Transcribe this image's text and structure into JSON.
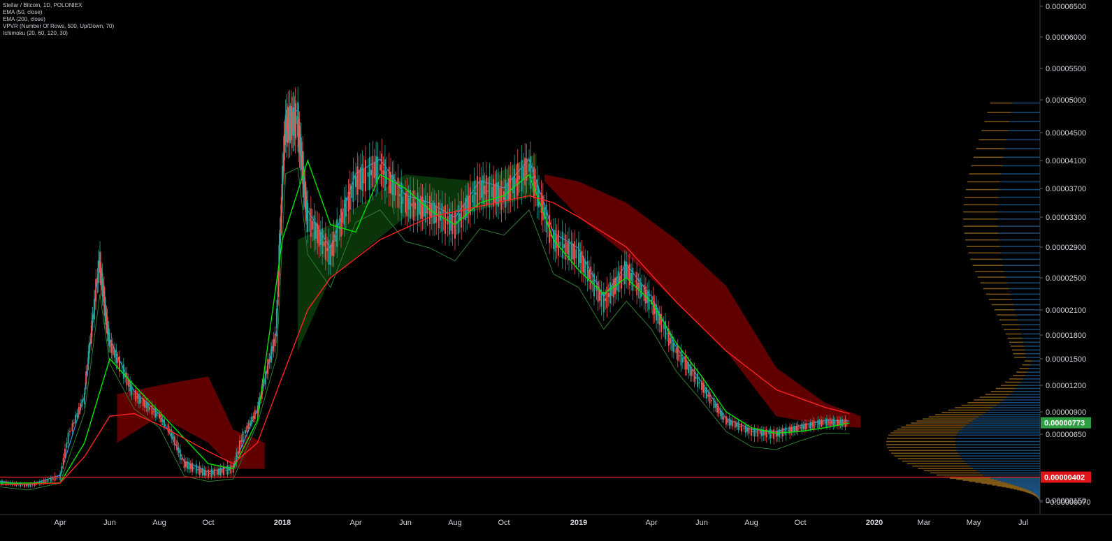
{
  "legend": {
    "symbol_line": "Stellar / Bitcoin, 1D, POLONIEX",
    "indicators": [
      "EMA (50, close)",
      "EMA (200, close)",
      "VPVR (Number Of Rows, 500, Up/Down, 70)",
      "Ichimoku (20, 60, 120, 30)"
    ]
  },
  "colors": {
    "background": "#000000",
    "candle_up": "#26a69a",
    "candle_down": "#ef5350",
    "ema50": "#00e600",
    "ema200": "#ff2222",
    "conversion_line": "#2196f3",
    "base_line": "#b71c1c",
    "lagging_span": "#2e7d32",
    "cloud_bearish": "#6b0000",
    "cloud_bullish": "#0b3a0b",
    "vpvr_up": "#1e5a8c",
    "vpvr_down": "#a0701c",
    "price_line": "#ff2222",
    "last_price_badge": "#2ea043",
    "level_badge": "#e0161b"
  },
  "chart_data": {
    "type": "candlestick",
    "title": "Stellar / Bitcoin, 1D, POLONIEX",
    "x_axis": {
      "tick_labels": [
        "Apr",
        "Jun",
        "Aug",
        "Oct",
        "2018",
        "Apr",
        "Jun",
        "Aug",
        "Oct",
        "2019",
        "Apr",
        "Jun",
        "Aug",
        "Oct",
        "2020",
        "Mar",
        "May",
        "Jul"
      ],
      "range": [
        "2017-02",
        "2020-07"
      ]
    },
    "y_axis": {
      "tick_labels": [
        "0.00006500",
        "0.00006000",
        "0.00005500",
        "0.00005000",
        "0.00004500",
        "0.00004100",
        "0.00003700",
        "0.00003300",
        "0.00002900",
        "0.00002500",
        "0.00002100",
        "0.00001800",
        "0.00001500",
        "0.00001200",
        "0.00000900",
        "0.00000650",
        "0.00000150",
        "−0.00000070"
      ],
      "scale": "log"
    },
    "last_price": "0.00000773",
    "horizontal_level": "0.00000402",
    "series": [
      {
        "name": "Stellar / Bitcoin",
        "x": [
          "2017-02",
          "2017-03",
          "2017-04",
          "2017-05",
          "2017-05-20",
          "2017-06",
          "2017-07",
          "2017-08",
          "2017-09",
          "2017-10",
          "2017-11",
          "2017-12",
          "2017-12-25",
          "2018-01-05",
          "2018-01-20",
          "2018-02",
          "2018-03",
          "2018-04",
          "2018-05",
          "2018-06",
          "2018-07",
          "2018-08",
          "2018-09",
          "2018-10",
          "2018-11",
          "2018-12",
          "2019-01",
          "2019-02",
          "2019-03",
          "2019-04",
          "2019-05",
          "2019-06",
          "2019-07",
          "2019-08",
          "2019-09",
          "2019-10",
          "2019-11",
          "2019-12"
        ],
        "y": [
          3.5e-06,
          3.1e-06,
          4e-06,
          1.05e-05,
          2.7e-05,
          1.7e-05,
          1.1e-05,
          8.5e-06,
          4.8e-06,
          4.2e-06,
          4.5e-06,
          9e-06,
          1.8e-05,
          4.6e-05,
          4.7e-05,
          3.3e-05,
          2.8e-05,
          3.8e-05,
          4e-05,
          3.5e-05,
          3.4e-05,
          3.2e-05,
          3.7e-05,
          3.6e-05,
          4e-05,
          3e-05,
          2.8e-05,
          2.2e-05,
          2.6e-05,
          2.2e-05,
          1.6e-05,
          1.2e-05,
          8e-06,
          6.8e-06,
          6.6e-06,
          7.2e-06,
          7.8e-06,
          7.7e-06
        ]
      },
      {
        "name": "EMA (50, close)",
        "x": [
          "2017-02",
          "2017-04",
          "2017-05",
          "2017-06",
          "2017-07",
          "2017-08",
          "2017-10",
          "2017-11",
          "2017-12",
          "2018-01",
          "2018-02",
          "2018-03",
          "2018-04",
          "2018-05",
          "2018-06",
          "2018-07",
          "2018-08",
          "2018-09",
          "2018-10",
          "2018-11",
          "2018-12",
          "2019-01",
          "2019-02",
          "2019-03",
          "2019-04",
          "2019-05",
          "2019-06",
          "2019-07",
          "2019-08",
          "2019-09",
          "2019-10",
          "2019-11",
          "2019-12"
        ],
        "y": [
          3.4e-06,
          3.4e-06,
          6e-06,
          1.5e-05,
          1.2e-05,
          9e-06,
          4.8e-06,
          4.5e-06,
          8e-06,
          3e-05,
          4.1e-05,
          3.2e-05,
          3.1e-05,
          3.9e-05,
          3.7e-05,
          3.4e-05,
          3.2e-05,
          3.5e-05,
          3.6e-05,
          3.9e-05,
          3e-05,
          2.6e-05,
          2.3e-05,
          2.5e-05,
          2.2e-05,
          1.7e-05,
          1.3e-05,
          9e-06,
          7.2e-06,
          6.6e-06,
          6.8e-06,
          7.2e-06,
          7.7e-06
        ]
      },
      {
        "name": "EMA (200, close)",
        "x": [
          "2017-02",
          "2017-04",
          "2017-05",
          "2017-06",
          "2017-07",
          "2017-08",
          "2017-10",
          "2017-11",
          "2017-12",
          "2018-01",
          "2018-02",
          "2018-03",
          "2018-05",
          "2018-07",
          "2018-09",
          "2018-11",
          "2018-12",
          "2019-01",
          "2019-03",
          "2019-05",
          "2019-07",
          "2019-09",
          "2019-11",
          "2019-12"
        ],
        "y": [
          3.2e-06,
          3.4e-06,
          5.2e-06,
          8.5e-06,
          8.8e-06,
          7.5e-06,
          5.5e-06,
          4.8e-06,
          6e-06,
          1.3e-05,
          2.1e-05,
          2.5e-05,
          3e-05,
          3.3e-05,
          3.45e-05,
          3.6e-05,
          3.5e-05,
          3.3e-05,
          2.9e-05,
          2.2e-05,
          1.6e-05,
          1.15e-05,
          9.5e-06,
          8.8e-06
        ]
      }
    ]
  }
}
